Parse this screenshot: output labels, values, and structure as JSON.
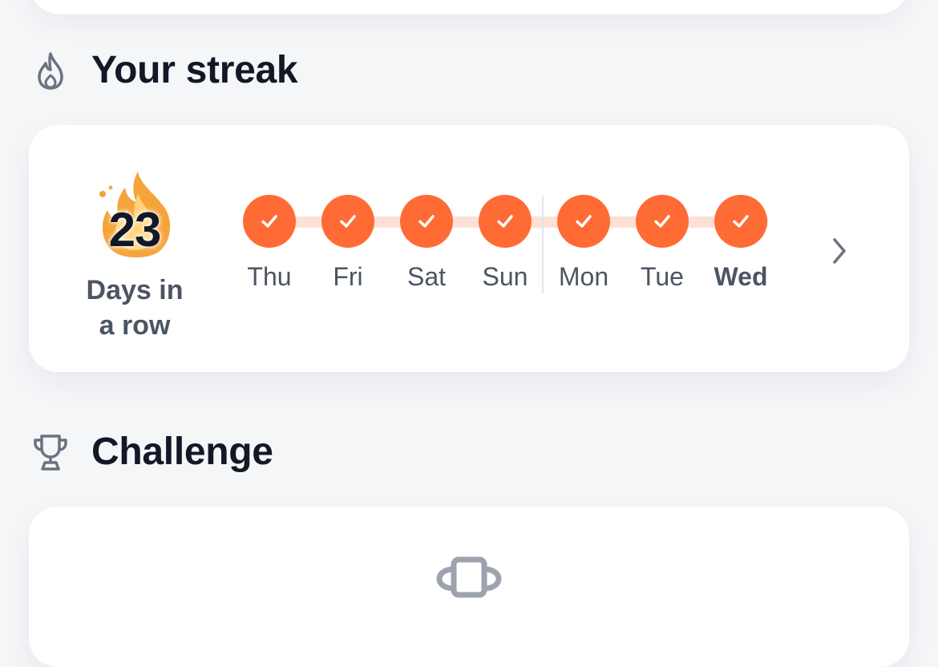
{
  "streak_section": {
    "title": "Your streak",
    "icon": "flame-outline-icon"
  },
  "streak_card": {
    "count": "23",
    "caption_line1": "Days in",
    "caption_line2": "a row",
    "days": [
      {
        "label": "Thu",
        "done": true
      },
      {
        "label": "Fri",
        "done": true
      },
      {
        "label": "Sat",
        "done": true
      },
      {
        "label": "Sun",
        "done": true
      },
      {
        "label": "Mon",
        "done": true
      },
      {
        "label": "Tue",
        "done": true
      },
      {
        "label": "Wed",
        "done": true,
        "today": true
      }
    ],
    "accent_color": "#ff6b35",
    "track_color": "#fde1d6",
    "next_icon": "chevron-right-icon"
  },
  "challenge_section": {
    "title": "Challenge",
    "icon": "trophy-outline-icon"
  }
}
